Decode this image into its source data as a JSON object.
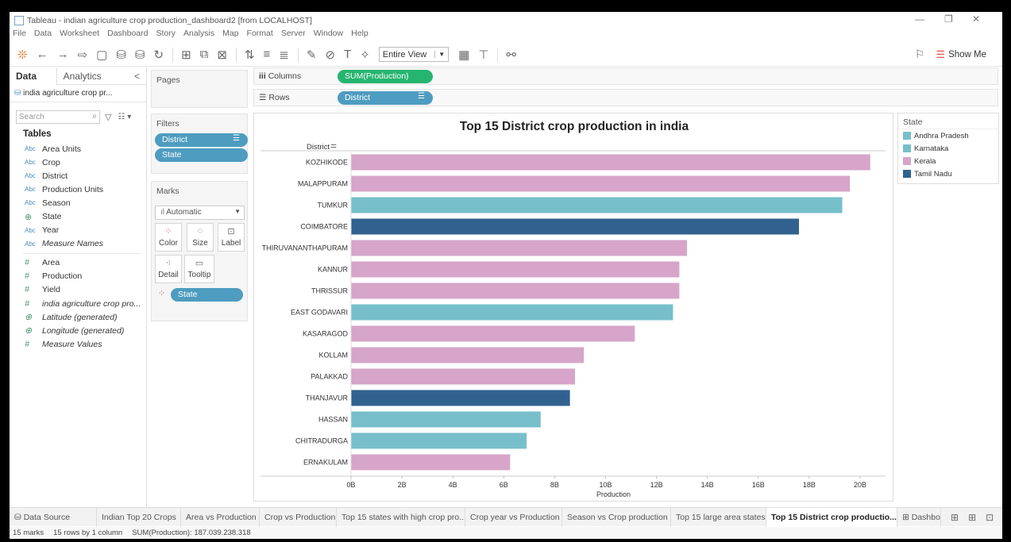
{
  "window": {
    "title": "Tableau - indian agriculture crop production_dashboard2 [from LOCALHOST]",
    "minimize": "—",
    "restore": "❐",
    "close": "✕"
  },
  "menu": [
    "File",
    "Data",
    "Worksheet",
    "Dashboard",
    "Story",
    "Analysis",
    "Map",
    "Format",
    "Server",
    "Window",
    "Help"
  ],
  "toolbar": {
    "fit_label": "Entire View",
    "show_me_label": "Show Me"
  },
  "data_pane": {
    "tab_data": "Data",
    "tab_analytics": "Analytics",
    "collapse": "<",
    "datasource_name": "india agriculture crop pr...",
    "search_placeholder": "Search",
    "tables_label": "Tables",
    "dimensions": [
      {
        "type": "Abc",
        "name": "Area Units"
      },
      {
        "type": "Abc",
        "name": "Crop"
      },
      {
        "type": "Abc",
        "name": "District"
      },
      {
        "type": "Abc",
        "name": "Production Units"
      },
      {
        "type": "Abc",
        "name": "Season"
      },
      {
        "type": "geo",
        "name": "State"
      },
      {
        "type": "Abc",
        "name": "Year"
      },
      {
        "type": "Abc",
        "name": "Measure Names"
      }
    ],
    "measures": [
      {
        "type": "#",
        "name": "Area"
      },
      {
        "type": "#",
        "name": "Production"
      },
      {
        "type": "#",
        "name": "Yield"
      },
      {
        "type": "#",
        "name": "india agriculture crop pro..."
      },
      {
        "type": "geo",
        "name": "Latitude (generated)"
      },
      {
        "type": "geo",
        "name": "Longitude (generated)"
      },
      {
        "type": "#",
        "name": "Measure Values"
      }
    ]
  },
  "cards": {
    "pages_label": "Pages",
    "filters_label": "Filters",
    "filters": [
      "District",
      "State"
    ],
    "marks_label": "Marks",
    "mark_type": "Automatic",
    "mark_buttons": [
      "Color",
      "Size",
      "Label",
      "Detail",
      "Tooltip"
    ],
    "color_field": "State"
  },
  "shelves": {
    "columns_label": "Columns",
    "columns_pill": "SUM(Production)",
    "rows_label": "Rows",
    "rows_pill": "District"
  },
  "legend": {
    "title": "State",
    "items": [
      {
        "name": "Andhra Pradesh",
        "color": "#76bfca"
      },
      {
        "name": "Karnataka",
        "color": "#76bfca"
      },
      {
        "name": "Kerala",
        "color": "#d6a5c9"
      },
      {
        "name": "Tamil Nadu",
        "color": "#31628f"
      }
    ]
  },
  "colors": {
    "Andhra Pradesh": "#76bfca",
    "Karnataka": "#76bfca",
    "Kerala": "#d6a5c9",
    "Tamil Nadu": "#31628f",
    "pill": "#4e9cc0",
    "pill_green": "#26b570"
  },
  "chart_data": {
    "type": "bar",
    "orientation": "horizontal",
    "title": "Top 15 District crop production in india",
    "row_header": "District",
    "xlabel": "Production",
    "xlim": [
      0,
      21
    ],
    "x_ticks": [
      "0B",
      "2B",
      "4B",
      "6B",
      "8B",
      "10B",
      "12B",
      "14B",
      "16B",
      "18B",
      "20B"
    ],
    "x_tick_values": [
      0,
      2,
      4,
      6,
      8,
      10,
      12,
      14,
      16,
      18,
      20
    ],
    "categories": [
      "KOZHIKODE",
      "MALAPPURAM",
      "TUMKUR",
      "COIMBATORE",
      "THIRUVANANTHAPURAM",
      "KANNUR",
      "THRISSUR",
      "EAST GODAVARI",
      "KASARAGOD",
      "KOLLAM",
      "PALAKKAD",
      "THANJAVUR",
      "HASSAN",
      "CHITRADURGA",
      "ERNAKULAM"
    ],
    "values": [
      20.4,
      19.6,
      19.3,
      17.6,
      13.2,
      12.9,
      12.9,
      12.65,
      11.15,
      9.15,
      8.8,
      8.6,
      7.45,
      6.9,
      6.25
    ],
    "states": [
      "Kerala",
      "Kerala",
      "Karnataka",
      "Tamil Nadu",
      "Kerala",
      "Kerala",
      "Kerala",
      "Andhra Pradesh",
      "Kerala",
      "Kerala",
      "Kerala",
      "Tamil Nadu",
      "Karnataka",
      "Karnataka",
      "Kerala"
    ],
    "unit": "billions"
  },
  "sheet_tabs": [
    {
      "label": "Data Source",
      "active": false
    },
    {
      "label": "Indian Top 20 Crops",
      "active": false
    },
    {
      "label": "Area vs Production",
      "active": false
    },
    {
      "label": "Crop vs Production",
      "active": false
    },
    {
      "label": "Top 15 states with high crop pro...",
      "active": false
    },
    {
      "label": "Crop year vs Production",
      "active": false
    },
    {
      "label": "Season vs Crop production",
      "active": false
    },
    {
      "label": "Top 15 large area states",
      "active": false
    },
    {
      "label": "Top 15 District crop productio...",
      "active": true
    },
    {
      "label": "Dashbo",
      "active": false
    }
  ],
  "status": {
    "marks": "15 marks",
    "dims": "15 rows by 1 column",
    "sum": "SUM(Production): 187.039.238.318"
  }
}
